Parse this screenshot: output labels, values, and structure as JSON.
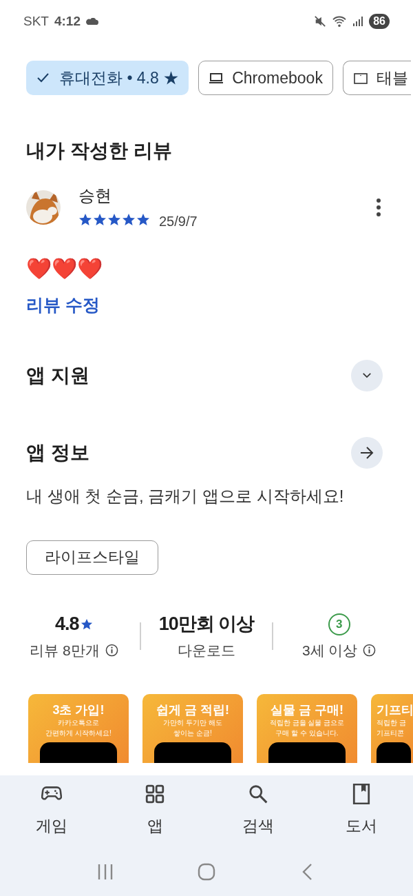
{
  "status_bar": {
    "carrier": "SKT",
    "time": "4:12",
    "battery": "86"
  },
  "device_chips": [
    {
      "label": "휴대전화 • 4.8 ★",
      "kind": "phone",
      "selected": true
    },
    {
      "label": "Chromebook",
      "kind": "laptop",
      "selected": false
    },
    {
      "label": "태블",
      "kind": "tablet",
      "selected": false
    }
  ],
  "my_review": {
    "title": "내가 작성한 리뷰",
    "author": "승현",
    "stars": 5,
    "date": "25/9/7",
    "text": "❤️❤️❤️",
    "edit_link": "리뷰 수정"
  },
  "sections": [
    {
      "title": "앱 지원",
      "kind": "expand"
    },
    {
      "title": "앱 정보",
      "kind": "arrow"
    }
  ],
  "description": "내 생애 첫 순금, 금캐기 앱으로 시작하세요!",
  "category": "라이프스타일",
  "stats": [
    {
      "kind": "rating",
      "value": "4.8",
      "label": "리뷰 8만개"
    },
    {
      "kind": "downloads",
      "value": "10만회 이상",
      "label": "다운로드"
    },
    {
      "kind": "age",
      "value": "3",
      "label": "3세 이상"
    }
  ],
  "screenshots": [
    {
      "headline": "3초 가입!",
      "caption": [
        "카카오톡으로",
        "간편하게 시작하세요!"
      ]
    },
    {
      "headline": "쉽게 금 적립!",
      "caption": [
        "가만히 두기만 해도",
        "쌓이는 순금!"
      ]
    },
    {
      "headline": "실물 금 구매!",
      "caption": [
        "적립한 금을 실물 금으로",
        "구매 할 수 있습니다."
      ]
    },
    {
      "headline": "기프티",
      "caption": [
        "적립한 금",
        "기프티콘"
      ]
    }
  ],
  "bottom_nav": [
    {
      "label": "게임",
      "kind": "games"
    },
    {
      "label": "앱",
      "kind": "apps"
    },
    {
      "label": "검색",
      "kind": "search"
    },
    {
      "label": "도서",
      "kind": "books"
    }
  ]
}
